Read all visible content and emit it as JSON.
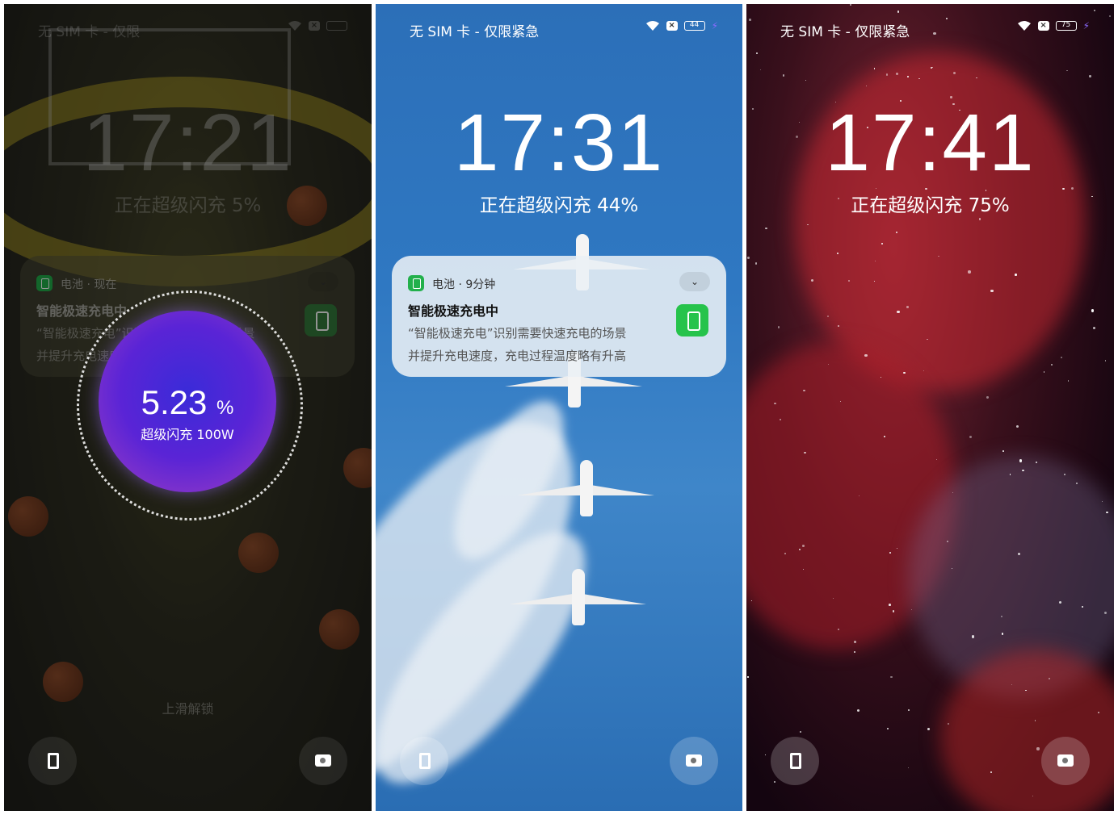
{
  "screens": [
    {
      "status": {
        "carrier": "无 SIM 卡 - 仅限",
        "battery": ""
      },
      "clock": "17:21",
      "charge_text": "正在超级闪充 5%",
      "notification": {
        "app": "电池 · 现在",
        "title": "智能极速充电中",
        "body_line1": "“智能极速充电”识别需要快速充电的场景",
        "body_line2": "并提升充电速度，充电过程温度略有升高"
      },
      "charge_overlay": {
        "percent": "5.23",
        "percent_sign": "%",
        "label": "超级闪充 100W"
      },
      "unlock_hint": "上滑解锁"
    },
    {
      "status": {
        "carrier": "无 SIM 卡 - 仅限紧急",
        "battery": "44"
      },
      "clock": "17:31",
      "charge_text": "正在超级闪充 44%",
      "notification": {
        "app": "电池 · 9分钟",
        "title": "智能极速充电中",
        "body_line1": "“智能极速充电”识别需要快速充电的场景",
        "body_line2": "并提升充电速度，充电过程温度略有升高"
      }
    },
    {
      "status": {
        "carrier": "无 SIM 卡 - 仅限紧急",
        "battery": "75"
      },
      "clock": "17:41",
      "charge_text": "正在超级闪充 75%"
    }
  ],
  "colors": {
    "accent_green": "#26c34b",
    "charge_purple": "#5a24d6",
    "bolt": "#8b6bff"
  },
  "icons": {
    "left_shortcut": "document-icon",
    "right_shortcut": "camera-icon"
  }
}
